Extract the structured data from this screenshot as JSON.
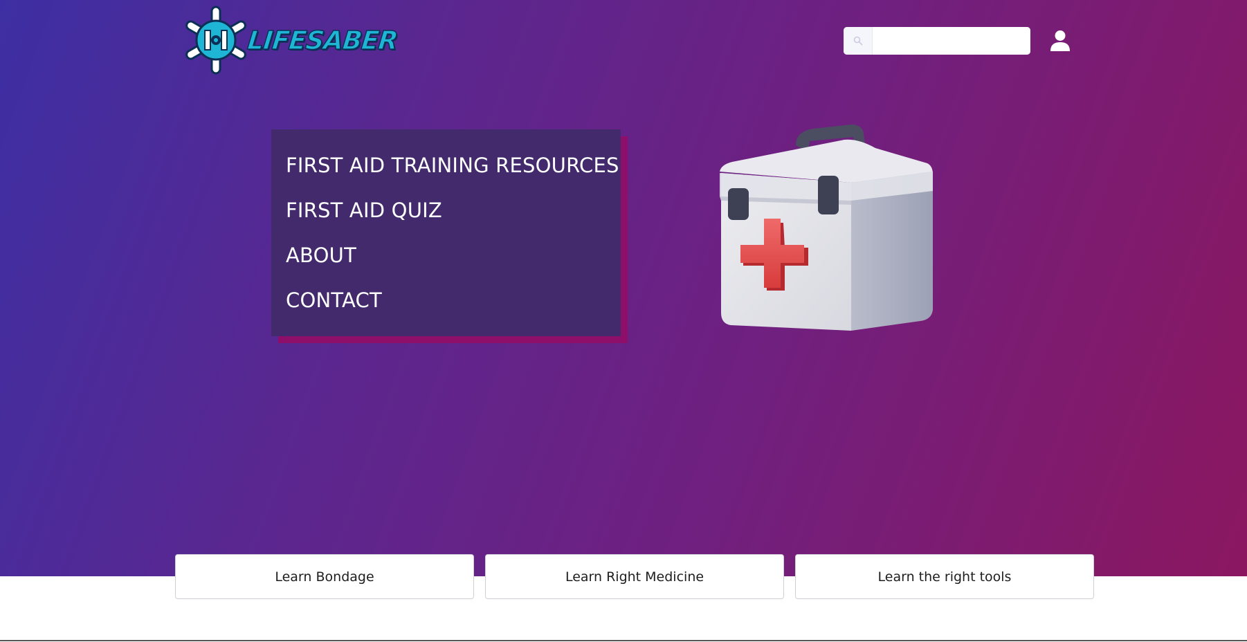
{
  "brand": {
    "name": "LIFESABER",
    "colors": {
      "primary": "#1fb6d6",
      "outline": "#0b2f55"
    }
  },
  "header": {
    "search": {
      "placeholder": "",
      "value": "",
      "icon": "search-icon"
    },
    "account_icon": "user-icon"
  },
  "menu": {
    "items": [
      {
        "label": "FIRST AID TRAINING RESOURCES"
      },
      {
        "label": "FIRST AID QUIZ"
      },
      {
        "label": "ABOUT"
      },
      {
        "label": "CONTACT"
      }
    ],
    "colors": {
      "panel": "#432a6c",
      "accent_shadow": "#8e0f6a"
    }
  },
  "hero": {
    "illustration": "first-aid-kit",
    "gradient": [
      "#3d2fa3",
      "#5a2790",
      "#6f2080",
      "#8b1760"
    ]
  },
  "cards": [
    {
      "label": "Learn Bondage"
    },
    {
      "label": "Learn Right Medicine"
    },
    {
      "label": "Learn the right tools"
    }
  ]
}
